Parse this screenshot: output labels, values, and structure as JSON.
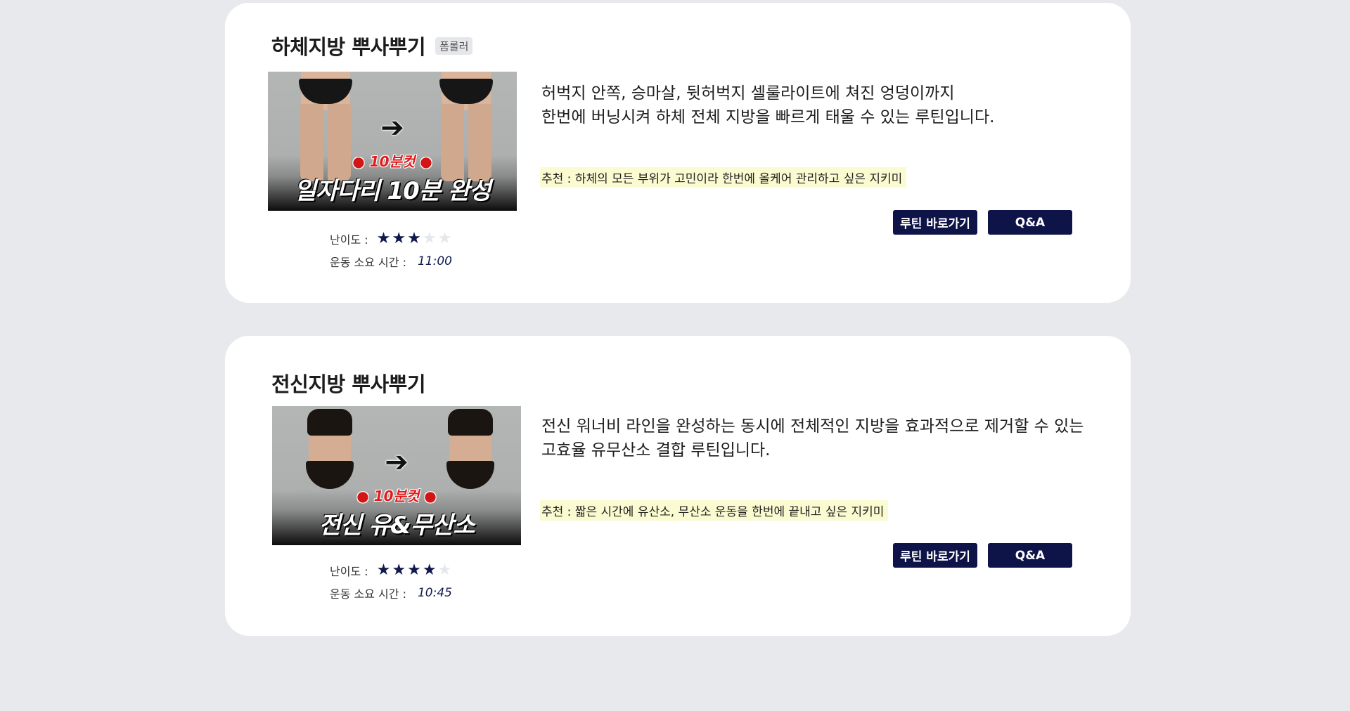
{
  "cards": [
    {
      "title": "하체지방 뿌사뿌기",
      "tag": "폼롤러",
      "thumbnail": {
        "badge": "10분컷",
        "caption": "일자다리 10분 완성",
        "arrow": "arrow-right-icon"
      },
      "difficulty_label": "난이도 :",
      "difficulty_rating": 3,
      "difficulty_max": 5,
      "time_label": "운동 소요 시간 :",
      "time_value": "11:00",
      "description_line1": "허벅지 안쪽, 승마살, 뒷허벅지 셀룰라이트에 쳐진 엉덩이까지",
      "description_line2": "한번에 버닝시켜 하체 전체 지방을 빠르게 태울 수 있는 루틴입니다.",
      "recommend": "추천 : 하체의 모든 부위가 고민이라 한번에 올케어 관리하고 싶은 지키미",
      "routine_button": "루틴 바로가기",
      "qa_button": "Q&A"
    },
    {
      "title": "전신지방 뿌사뿌기",
      "tag": "",
      "thumbnail": {
        "badge": "10분컷",
        "caption": "전신 유&무산소",
        "arrow": "arrow-right-icon"
      },
      "difficulty_label": "난이도 :",
      "difficulty_rating": 4,
      "difficulty_max": 5,
      "time_label": "운동 소요 시간 :",
      "time_value": "10:45",
      "description_line1": "전신 워너비 라인을 완성하는 동시에 전체적인 지방을 효과적으로 제거할 수 있는",
      "description_line2": "고효율 유무산소 결합 루틴입니다.",
      "recommend": "추천 : 짧은 시간에 유산소, 무산소 운동을 한번에 끝내고 싶은 지키미",
      "routine_button": "루틴 바로가기",
      "qa_button": "Q&A"
    }
  ],
  "colors": {
    "background": "#e8e9ec",
    "card": "#ffffff",
    "button": "#0e1448",
    "star_on": "#10194e",
    "star_off": "#e6e7ea",
    "highlight": "#fbfbd1"
  }
}
